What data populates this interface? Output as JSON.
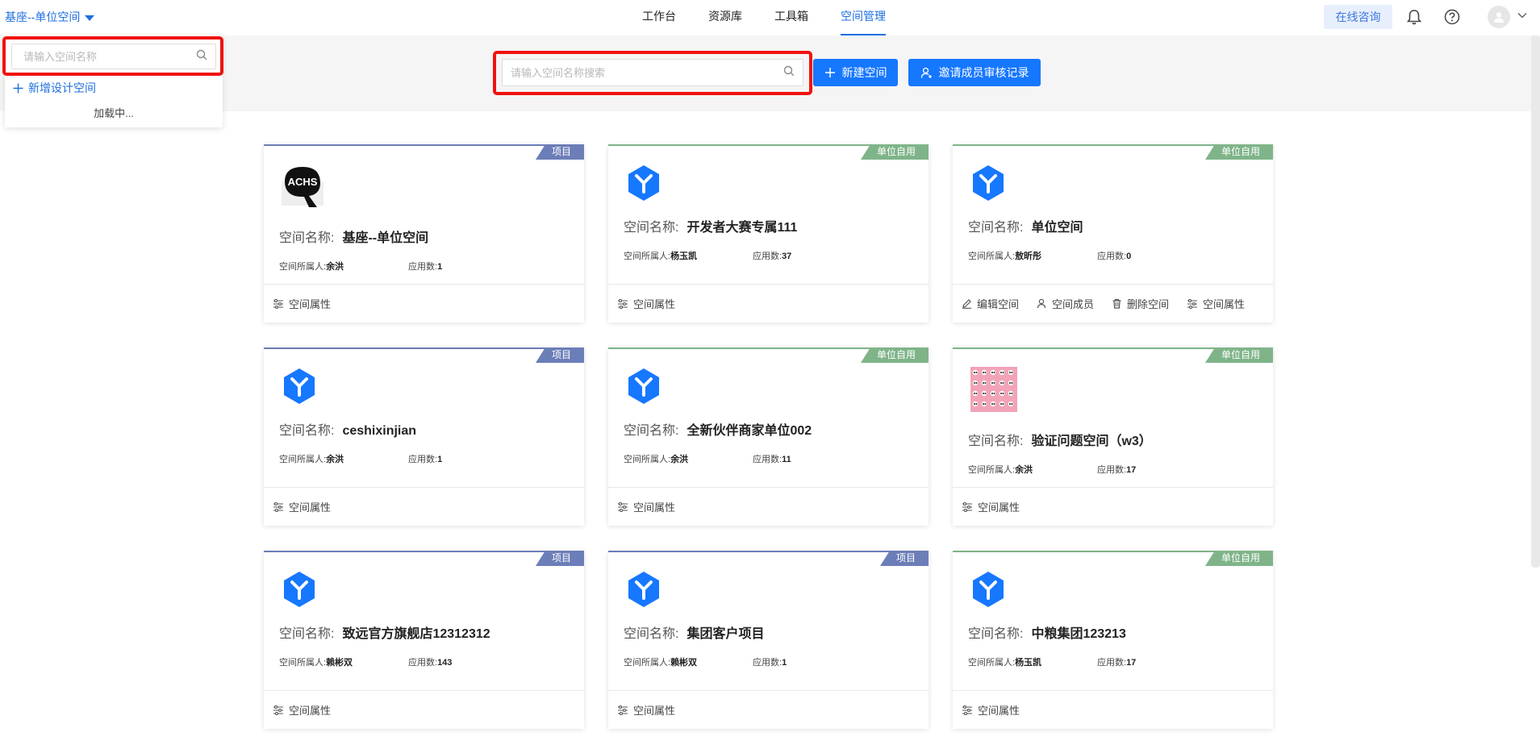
{
  "header": {
    "current_space": "基座--单位空间",
    "nav": [
      "工作台",
      "资源库",
      "工具箱",
      "空间管理"
    ],
    "active_nav": 3,
    "consult": "在线咨询"
  },
  "dropdown": {
    "placeholder": "请输入空间名称",
    "add_label": "新增设计空间",
    "loading": "加载中..."
  },
  "toolbar": {
    "search_placeholder": "请输入空间名称搜索",
    "new_space": "新建空间",
    "invite_records": "邀请成员审核记录"
  },
  "labels": {
    "space_name": "空间名称:",
    "owner": "空间所属人:",
    "apps": "应用数:",
    "edit": "编辑空间",
    "members": "空间成员",
    "delete": "删除空间",
    "props": "空间属性"
  },
  "colors": {
    "accent": "#1677ff",
    "project_tag": "#6c7eb8",
    "unit_tag": "#7fb489",
    "highlight": "#f0120f"
  },
  "cards": [
    {
      "tag": "项目",
      "kind": "project",
      "logo": "achs-logo",
      "logo_text": "ACHS",
      "name": "基座--单位空间",
      "owner": "余洪",
      "apps": "1",
      "actions": [
        "props"
      ]
    },
    {
      "tag": "单位自用",
      "kind": "unit",
      "logo": "cube-icon",
      "name": "开发者大赛专属111",
      "owner": "杨玉凯",
      "apps": "37",
      "actions": [
        "props"
      ]
    },
    {
      "tag": "单位自用",
      "kind": "unit",
      "logo": "cube-icon",
      "name": "单位空间",
      "owner": "敖昕彤",
      "apps": "0",
      "actions": [
        "edit",
        "members",
        "delete",
        "props"
      ]
    },
    {
      "tag": "项目",
      "kind": "project",
      "logo": "cube-icon",
      "name": "ceshixinjian",
      "owner": "余洪",
      "apps": "1",
      "actions": [
        "props"
      ]
    },
    {
      "tag": "单位自用",
      "kind": "unit",
      "logo": "cube-icon",
      "name": "全新伙伴商家单位002",
      "owner": "余洪",
      "apps": "11",
      "actions": [
        "props"
      ]
    },
    {
      "tag": "单位自用",
      "kind": "unit",
      "logo": "panda-pattern-image",
      "name": "验证问题空间（w3）",
      "owner": "余洪",
      "apps": "17",
      "actions": [
        "props"
      ]
    },
    {
      "tag": "项目",
      "kind": "project",
      "logo": "cube-icon",
      "name": "致远官方旗舰店12312312",
      "owner": "赖彬双",
      "apps": "143",
      "actions": [
        "props"
      ]
    },
    {
      "tag": "项目",
      "kind": "project",
      "logo": "cube-icon",
      "name": "集团客户项目",
      "owner": "赖彬双",
      "apps": "1",
      "actions": [
        "props"
      ]
    },
    {
      "tag": "单位自用",
      "kind": "unit",
      "logo": "cube-icon",
      "name": "中粮集团123213",
      "owner": "杨玉凯",
      "apps": "17",
      "actions": [
        "props"
      ]
    }
  ]
}
